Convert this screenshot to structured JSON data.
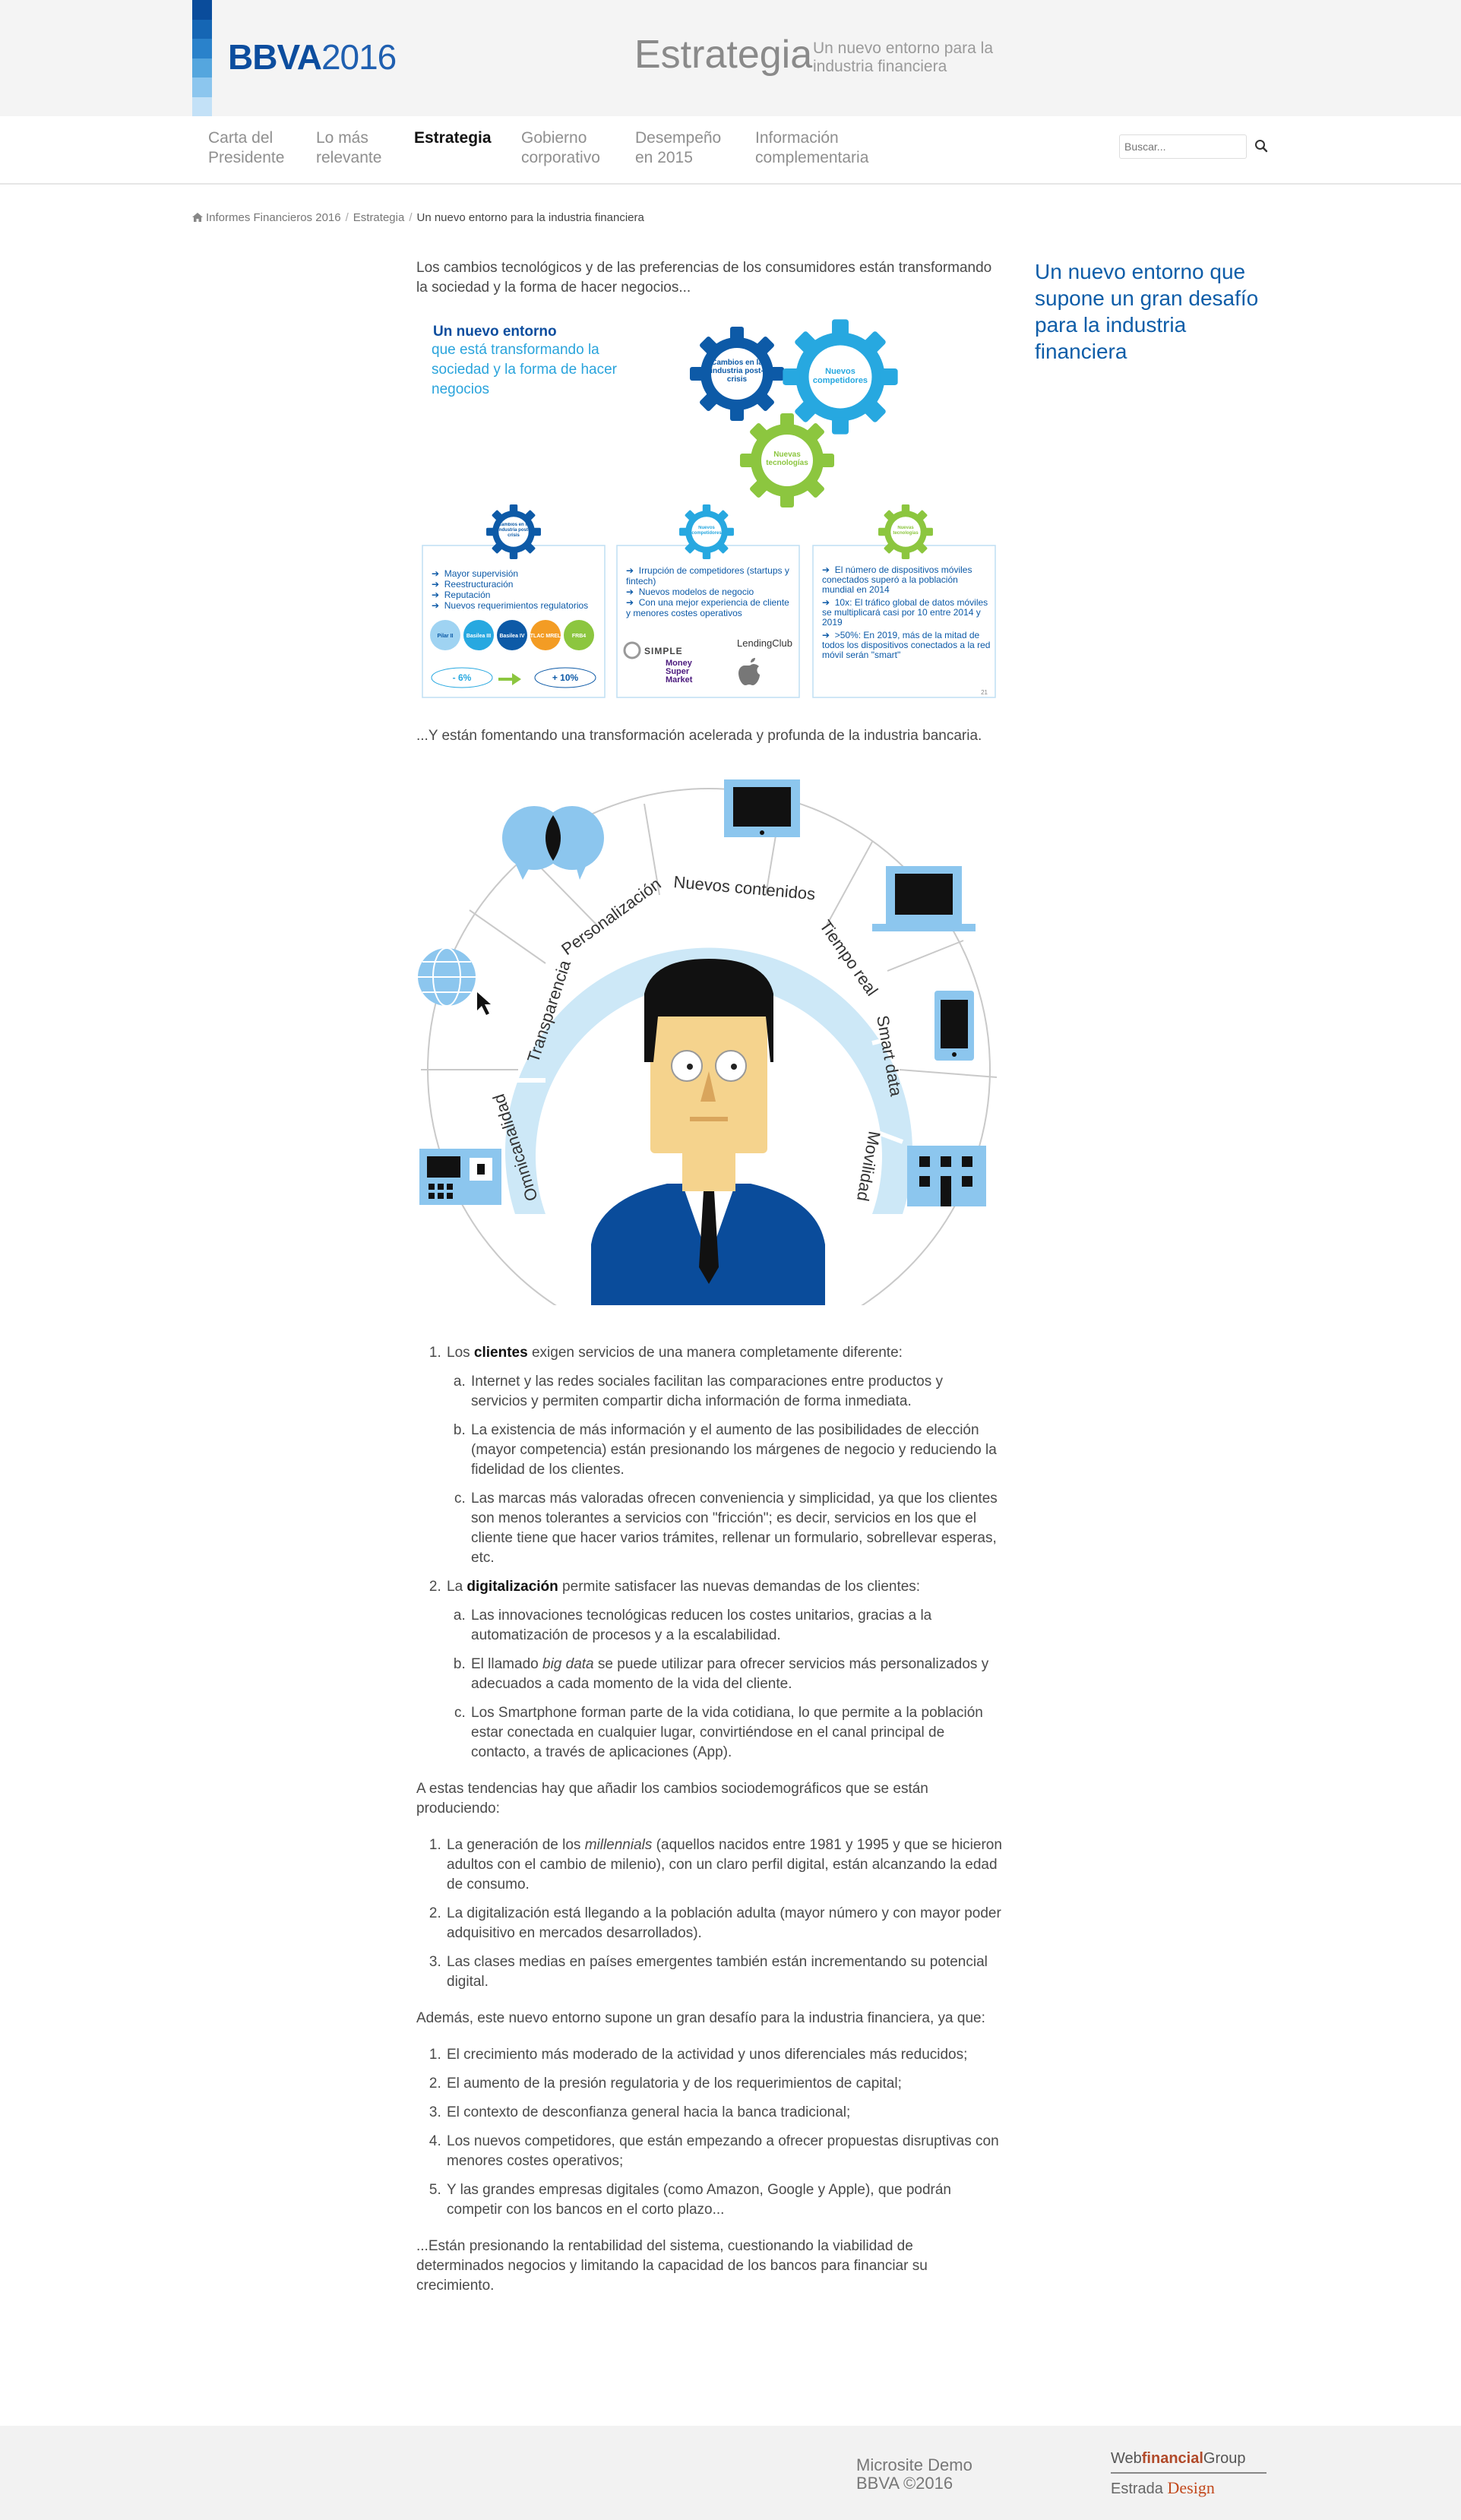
{
  "header": {
    "logo_brand": "BBVA",
    "logo_year": "2016",
    "section_title": "Estrategia",
    "section_subtitle": "Un nuevo entorno para la industria financiera",
    "logo_strip_colors": [
      "#0a4c9b",
      "#1566b4",
      "#2a82cb",
      "#55a6de",
      "#8cc6ee",
      "#c3e1f7"
    ]
  },
  "nav": {
    "items": [
      {
        "label": "Carta del Presidente"
      },
      {
        "label": "Lo más relevante"
      },
      {
        "label": "Estrategia",
        "active": true
      },
      {
        "label": "Gobierno corporativo"
      },
      {
        "label": "Desempeño en 2015"
      },
      {
        "label": "Información complementaria"
      }
    ],
    "search_placeholder": "Buscar..."
  },
  "breadcrumb": {
    "home": "Informes Financieros 2016",
    "parent": "Estrategia",
    "current": "Un nuevo entorno para la industria financiera"
  },
  "aside_title": "Un nuevo entorno que supone un gran desafío para la industria financiera",
  "infographic": {
    "title_line1": "Un nuevo entorno",
    "title_rest": "que está transformando la sociedad y la forma de hacer negocios",
    "gear_center": "Cambios en la industria post-crisis",
    "gear_right": "Nuevos competidores",
    "gear_bottom": "Nuevas tecnologías",
    "col1_gear": "Cambios en la industria post-crisis",
    "col1_items": [
      "Mayor supervisión",
      "Reestructuración",
      "Reputación",
      "Nuevos requerimientos regulatorios"
    ],
    "col1_badges": [
      "Pilar II",
      "Basilea III",
      "Basilea IV",
      "TLAC MREL",
      "FRB4"
    ],
    "col1_foot_left": "- 6%",
    "col1_foot_right": "+ 10%",
    "col2_gear": "Nuevos competidores",
    "col2_items": [
      "Irrupción de competidores (startups y fintech)",
      "Nuevos modelos de negocio",
      "Con una mejor experiencia de cliente y menores costes operativos"
    ],
    "col2_logos": [
      "SIMPLE",
      "LendingClub",
      "Money Super Market"
    ],
    "col3_gear": "Nuevas tecnologías",
    "col3_items": [
      "El número de dispositivos móviles conectados superó a la población mundial en 2014",
      "10x: El tráfico global de datos móviles se multiplicará casi por 10 entre 2014 y 2019",
      ">50%: En 2019, más de la mitad de todos los dispositivos conectados a la red móvil serán \"smart\""
    ],
    "page_number": "21"
  },
  "illustration": {
    "labels": [
      "Omnicanalidad",
      "Transparencia",
      "Personalización",
      "Nuevos contenidos",
      "Tiempo real",
      "Smart data",
      "Movilidad"
    ]
  },
  "content": {
    "intro": "Los cambios tecnológicos y de las preferencias de los consumidores están transformando la sociedad y la forma de hacer negocios...",
    "intro2": "...Y están fomentando una transformación acelerada y profunda de la industria bancaria.",
    "list1": [
      {
        "pre": "Los ",
        "kw": "clientes",
        "post": " exigen servicios de una manera completamente diferente:",
        "sub": [
          "Internet y las redes sociales facilitan las comparaciones entre productos y servicios y permiten compartir dicha información de forma inmediata.",
          "La existencia de más información y el aumento de las posibilidades de elección (mayor competencia) están presionando los márgenes de negocio y reduciendo la fidelidad de los clientes.",
          "Las marcas más valoradas ofrecen conveniencia y simplicidad, ya que los clientes son menos tolerantes a servicios con \"fricción\"; es decir, servicios en los que el cliente tiene que hacer varios trámites, rellenar un formulario, sobrellevar esperas, etc."
        ]
      },
      {
        "pre": "La ",
        "kw": "digitalización",
        "post": " permite satisfacer las nuevas demandas de los clientes:",
        "sub_b_pre": "El llamado ",
        "sub_b_em": "big data",
        "sub_b_post": " se puede utilizar para ofrecer servicios más personalizados y adecuados a cada momento de la vida del cliente.",
        "sub_a": "Las innovaciones tecnológicas reducen los costes unitarios, gracias a la automatización de procesos y a la escalabilidad.",
        "sub_c": "Los Smartphone forman parte de la vida cotidiana, lo que permite a la población estar conectada en cualquier lugar, convirtiéndose en el canal principal de contacto, a través de aplicaciones (App)."
      }
    ],
    "trends_intro": "A estas tendencias hay que añadir los cambios sociodemográficos que se están produciendo:",
    "trends": {
      "t1_pre": "La generación de los ",
      "t1_em": "millennials",
      "t1_post": " (aquellos nacidos entre 1981 y 1995 y que se hicieron adultos con el cambio de milenio), con un claro perfil digital, están alcanzando la edad de consumo.",
      "t2": "La digitalización está llegando a la población adulta (mayor número y con mayor poder adquisitivo en mercados desarrollados).",
      "t3": "Las clases medias en países emergentes también están incrementando su potencial digital."
    },
    "challenge_intro": "Además, este nuevo entorno supone un gran desafío para la industria financiera, ya que:",
    "challenges": [
      "El crecimiento más moderado de la actividad y unos diferenciales más reducidos;",
      "El aumento de la presión regulatoria y de los requerimientos de capital;",
      "El contexto de desconfianza general hacia la banca tradicional;",
      "Los nuevos competidores, que están empezando a ofrecer propuestas disruptivas con menores costes operativos;",
      "Y las grandes empresas digitales (como Amazon, Google y Apple), que podrán competir con los bancos en el corto plazo..."
    ],
    "closing": "...Están presionando la rentabilidad del sistema, cuestionando la viabilidad de determinados negocios y limitando la capacidad de los bancos para financiar su crecimiento."
  },
  "footer": {
    "line1": "Microsite Demo",
    "line2": "BBVA ©2016",
    "brand_web": "Web",
    "brand_fin": "financial",
    "brand_group": "Group",
    "brand_estrada": "Estrada",
    "brand_design": "Design"
  }
}
